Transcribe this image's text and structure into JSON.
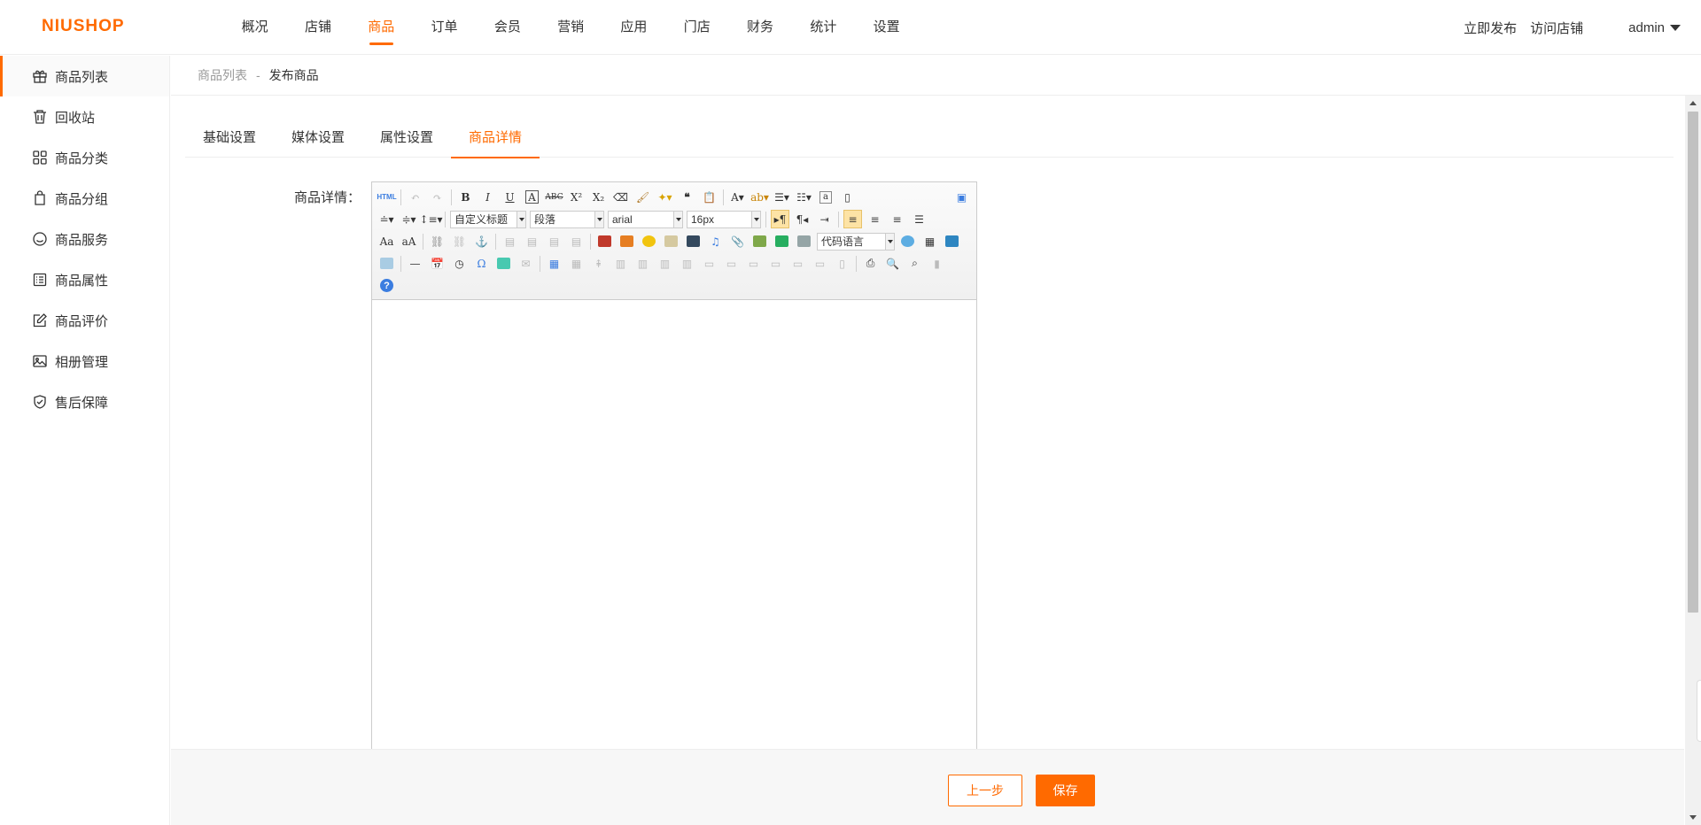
{
  "header": {
    "logo": "NIUSHOP",
    "nav": [
      "概况",
      "店铺",
      "商品",
      "订单",
      "会员",
      "营销",
      "应用",
      "门店",
      "财务",
      "统计",
      "设置"
    ],
    "active_nav": "商品",
    "links": {
      "publish": "立即发布",
      "visit": "访问店铺"
    },
    "user": "admin",
    "accent": "#ff6a00"
  },
  "sidebar": {
    "items": [
      {
        "label": "商品列表",
        "icon": "gift-icon",
        "active": true
      },
      {
        "label": "回收站",
        "icon": "trash-icon"
      },
      {
        "label": "商品分类",
        "icon": "grid-icon"
      },
      {
        "label": "商品分组",
        "icon": "bag-icon"
      },
      {
        "label": "商品服务",
        "icon": "smile-icon"
      },
      {
        "label": "商品属性",
        "icon": "list-icon"
      },
      {
        "label": "商品评价",
        "icon": "edit-icon"
      },
      {
        "label": "相册管理",
        "icon": "image-icon"
      },
      {
        "label": "售后保障",
        "icon": "shield-icon"
      }
    ]
  },
  "breadcrumb": {
    "parent": "商品列表",
    "sep": "-",
    "current": "发布商品"
  },
  "tabs": [
    "基础设置",
    "媒体设置",
    "属性设置",
    "商品详情"
  ],
  "active_tab": "商品详情",
  "form": {
    "detail_label": "商品详情："
  },
  "editor": {
    "heading_select": "自定义标题",
    "paragraph_select": "段落",
    "font_select": "arial",
    "size_select": "16px",
    "code_select": "代码语言",
    "html_button": "HTML",
    "help_icon": "?"
  },
  "footer": {
    "prev": "上一步",
    "save": "保存"
  }
}
